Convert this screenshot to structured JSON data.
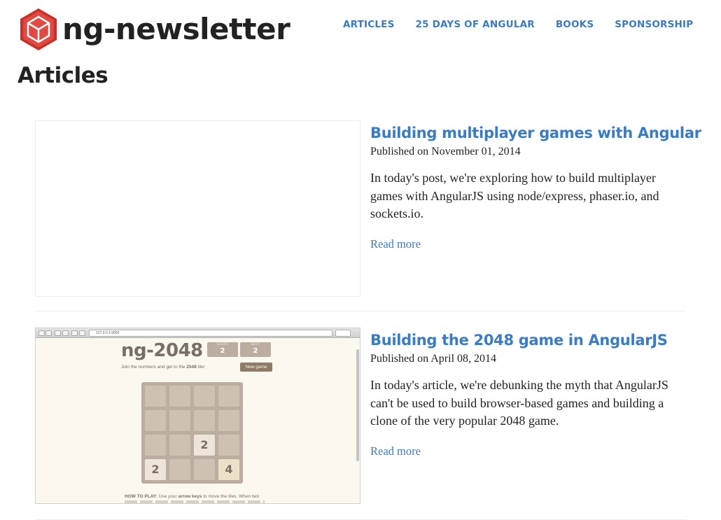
{
  "site": {
    "name": "ng-newsletter",
    "logo_icon": "hexagon-cube-icon",
    "accent_color": "#3a7cc2",
    "logo_color": "#d93a3a"
  },
  "nav": {
    "items": [
      {
        "label": "ARTICLES"
      },
      {
        "label": "25 DAYS OF ANGULAR"
      },
      {
        "label": "BOOKS"
      },
      {
        "label": "SPONSORSHIP"
      }
    ]
  },
  "page": {
    "title": "Articles"
  },
  "articles": [
    {
      "title": "Building multiplayer games with Angular",
      "date": "Published on November 01, 2014",
      "excerpt": "In today's post, we're exploring how to build multiplayer games with AngularJS using node/express, phaser.io, and sockets.io.",
      "read_more": "Read more"
    },
    {
      "title": "Building the 2048 game in AngularJS",
      "date": "Published on April 08, 2014",
      "excerpt": "In today's article, we're debunking the myth that AngularJS can't be used to build browser-based games and building a clone of the very popular 2048 game.",
      "read_more": "Read more",
      "thumbnail": {
        "url": "127.0.0.1:9000",
        "game_title": "ng-2048",
        "score_label": "SCORE",
        "score_value": "2",
        "best_label": "BEST",
        "best_value": "2",
        "intro_prefix": "Join the numbers and get to the ",
        "intro_bold": "2048",
        "intro_suffix": " tile!",
        "new_game": "New game",
        "howto_label": "HOW TO PLAY:",
        "howto_prefix": " Use your ",
        "howto_bold": "arrow keys",
        "howto_suffix": " to move the tiles. When two",
        "tiles": [
          {
            "row": 2,
            "col": 2,
            "value": "2"
          },
          {
            "row": 3,
            "col": 0,
            "value": "2"
          },
          {
            "row": 3,
            "col": 3,
            "value": "4"
          }
        ]
      }
    }
  ]
}
